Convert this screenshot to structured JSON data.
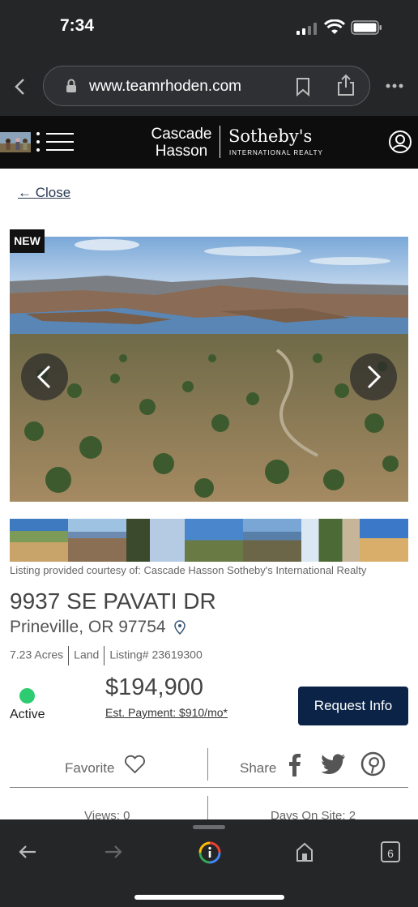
{
  "status_bar": {
    "time": "7:34"
  },
  "browser": {
    "url": "www.teamrhoden.com",
    "tab_count": "6"
  },
  "site_header": {
    "brand_left_line1": "Cascade",
    "brand_left_line2": "Hasson",
    "brand_right": "Sotheby's",
    "brand_sub": "INTERNATIONAL REALTY"
  },
  "close_label": "← Close",
  "photo": {
    "badge": "NEW",
    "thumbnail_count": 7
  },
  "courtesy": "Listing provided courtesy of: Cascade Hasson Sotheby's International Realty",
  "listing": {
    "address": "9937 SE PAVATI DR",
    "city_line": "Prineville, OR 97754",
    "acres": "7.23 Acres",
    "type": "Land",
    "listing_number": "Listing# 23619300",
    "status": "Active",
    "price": "$194,900",
    "est_payment": "Est. Payment: $910/mo*",
    "request_button": "Request Info"
  },
  "actions": {
    "favorite": "Favorite",
    "share": "Share"
  },
  "stats": {
    "views": "Views: 0",
    "days_on_site": "Days On Site: 2"
  },
  "colors": {
    "accent_navy": "#0a2347",
    "active_green": "#2ecc71",
    "chrome_dark": "#252628"
  }
}
